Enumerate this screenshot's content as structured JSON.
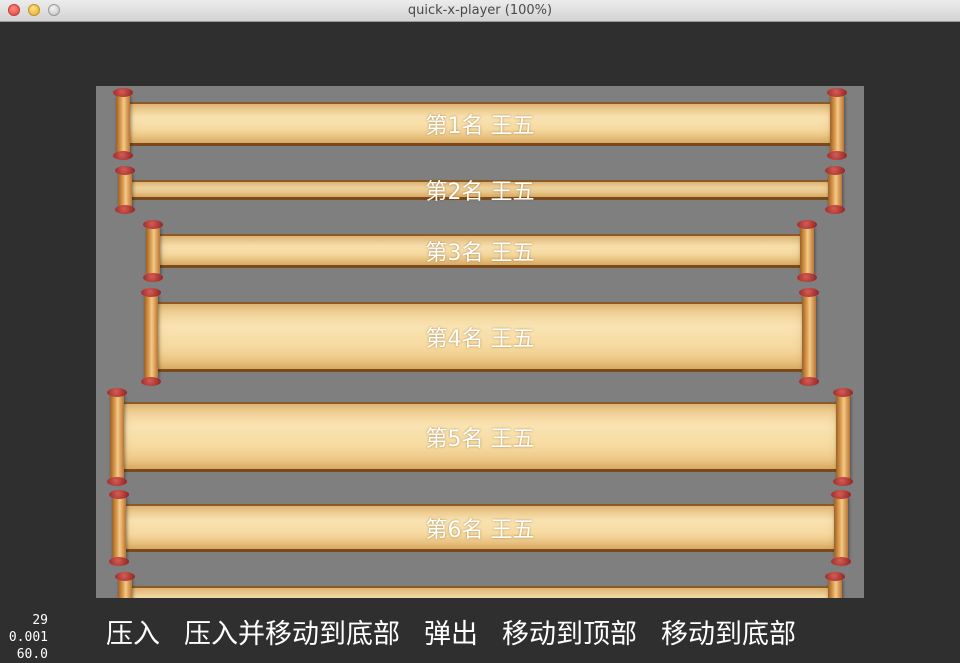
{
  "window": {
    "title": "quick-x-player (100%)"
  },
  "list": {
    "items": [
      {
        "label": "第1名 王五"
      },
      {
        "label": "第2名 王五"
      },
      {
        "label": "第3名 王五"
      },
      {
        "label": "第4名 王五"
      },
      {
        "label": "第5名 王五"
      },
      {
        "label": "第6名 王五"
      },
      {
        "label": ""
      }
    ]
  },
  "stats": {
    "line1": "29",
    "line2": "0.001",
    "line3": "60.0"
  },
  "menu": {
    "push": "压入",
    "push_move_bottom": "压入并移动到底部",
    "pop": "弹出",
    "move_top": "移动到顶部",
    "move_bottom": "移动到底部"
  }
}
